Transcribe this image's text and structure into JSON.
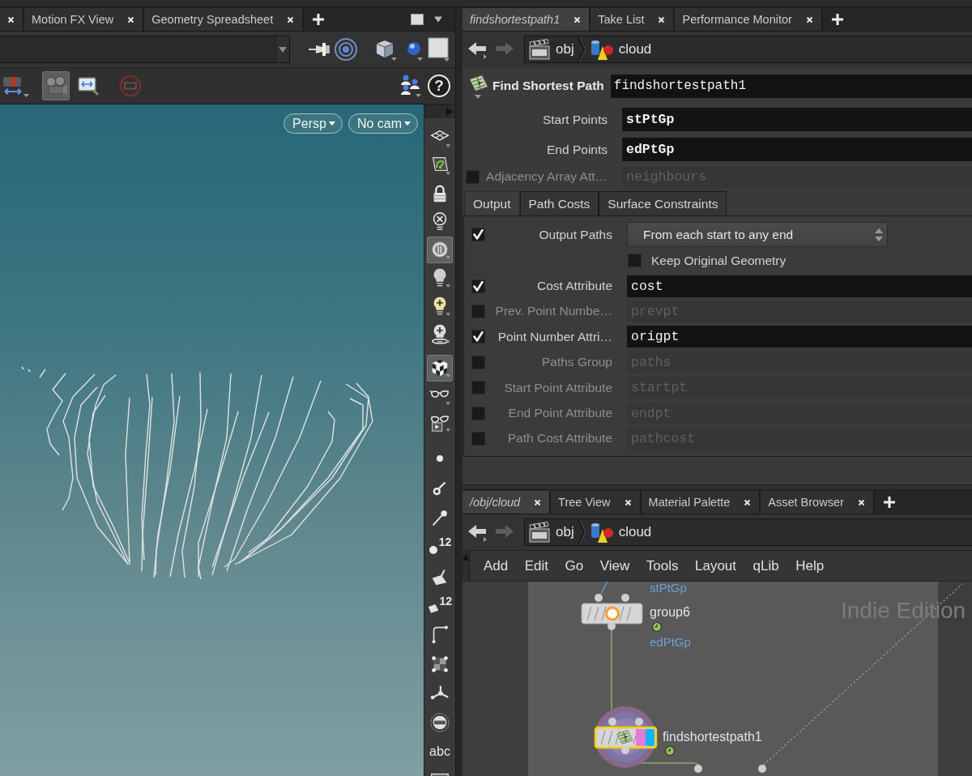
{
  "left_pane": {
    "tabs": [
      {
        "selected": false
      },
      {
        "label": "Motion FX View",
        "selected": false
      },
      {
        "label": "Geometry Spreadsheet",
        "selected": false
      }
    ],
    "viewer_tools": [
      {
        "on": false
      },
      {
        "on": true
      },
      {
        "on": false
      },
      {
        "on": false
      },
      {
        "on": false
      }
    ],
    "help_button": "?",
    "view_menus": [
      "Persp",
      "No cam"
    ],
    "display_tools": [
      {
        "on": false
      },
      {
        "on": false
      },
      {
        "on": false
      },
      {
        "on": false
      },
      {
        "on": true
      },
      {
        "on": false
      },
      {
        "on": false
      },
      {
        "on": false
      },
      {
        "on": true
      },
      {
        "on": false
      },
      {
        "on": false
      },
      {
        "on": false
      },
      {
        "on": false
      },
      {
        "on": false
      },
      {
        "on": false,
        "label": "12"
      },
      {
        "on": false
      },
      {
        "on": false,
        "label": "12"
      },
      {
        "on": false
      },
      {
        "on": false
      },
      {
        "on": false
      },
      {
        "on": false
      },
      {
        "on": false,
        "label": "abc"
      },
      {
        "on": false
      }
    ]
  },
  "parameter_pane": {
    "tabs": [
      {
        "label": "findshortestpath1",
        "selected": true
      },
      {
        "label": "Take List",
        "selected": false
      },
      {
        "label": "Performance Monitor",
        "selected": false
      }
    ],
    "path": [
      "obj",
      "cloud"
    ],
    "node_type": "Find Shortest Path",
    "node_name": "findshortestpath1",
    "parameters": [
      {
        "kind": "group",
        "label": "Start Points",
        "value": "stPtGp"
      },
      {
        "kind": "group",
        "label": "End Points",
        "value": "edPtGp"
      },
      {
        "kind": "toggle",
        "label": "Adjacency Array Att…",
        "value": "neighbours",
        "checked": false
      }
    ],
    "folder_tabs": [
      {
        "label": "Output",
        "selected": true
      },
      {
        "label": "Path Costs",
        "selected": false
      },
      {
        "label": "Surface Constraints",
        "selected": false
      }
    ],
    "output_parameters": [
      {
        "kind": "menu",
        "label": "Output Paths",
        "value": "From each start to any end",
        "checked": true
      },
      {
        "kind": "checkbox",
        "label": "Keep Original Geometry",
        "checked": false
      },
      {
        "kind": "toggle",
        "label": "Cost Attribute",
        "value": "cost",
        "checked": true
      },
      {
        "kind": "toggle",
        "label": "Prev. Point Numbe…",
        "value": "prevpt",
        "checked": false
      },
      {
        "kind": "toggle",
        "label": "Point Number Attri…",
        "value": "origpt",
        "checked": true
      },
      {
        "kind": "toggle",
        "label": "Paths Group",
        "value": "paths",
        "checked": false
      },
      {
        "kind": "toggle",
        "label": "Start Point Attribute",
        "value": "startpt",
        "checked": false
      },
      {
        "kind": "toggle",
        "label": "End Point Attribute",
        "value": "endpt",
        "checked": false
      },
      {
        "kind": "toggle",
        "label": "Path Cost Attribute",
        "value": "pathcost",
        "checked": false
      }
    ]
  },
  "network_pane": {
    "tabs": [
      {
        "label": "/obj/cloud",
        "selected": true
      },
      {
        "label": "Tree View",
        "selected": false
      },
      {
        "label": "Material Palette",
        "selected": false
      },
      {
        "label": "Asset Browser",
        "selected": false
      }
    ],
    "path": [
      "obj",
      "cloud"
    ],
    "menu": [
      "Add",
      "Edit",
      "Go",
      "View",
      "Tools",
      "Layout",
      "qLib",
      "Help"
    ],
    "edition_label": "Indie Edition",
    "cut_group_label": "stPtGp",
    "nodes": [
      {
        "name": "group6",
        "selected": false,
        "render_flag": false,
        "display_flag": false,
        "group_labels": [
          "edPtGp"
        ]
      },
      {
        "name": "findshortestpath1",
        "selected": true,
        "render_flag": true,
        "display_flag": true
      }
    ]
  }
}
